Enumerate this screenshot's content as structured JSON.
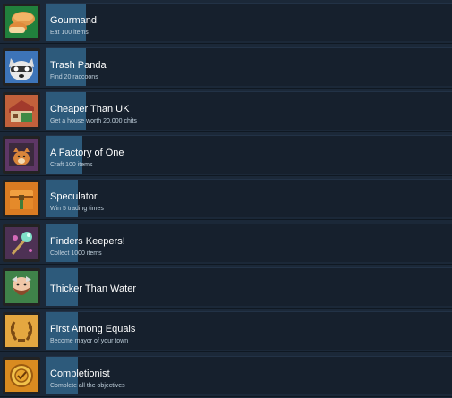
{
  "achievements": [
    {
      "title": "Gourmand",
      "description": "Eat 100 items",
      "icon": "bread-icon",
      "progress": 0.1
    },
    {
      "title": "Trash Panda",
      "description": "Find 20 raccoons",
      "icon": "raccoon-icon",
      "progress": 0.1
    },
    {
      "title": "Cheaper Than UK",
      "description": "Get a house worth 20,000 chits",
      "icon": "house-icon",
      "progress": 0.1
    },
    {
      "title": "A Factory of One",
      "description": "Craft 100 items",
      "icon": "crafting-fox-icon",
      "progress": 0.09
    },
    {
      "title": "Speculator",
      "description": "Win 5 trading times",
      "icon": "treasure-chest-icon",
      "progress": 0.08
    },
    {
      "title": "Finders Keepers!",
      "description": "Collect 1000 items",
      "icon": "gem-wand-icon",
      "progress": 0.08
    },
    {
      "title": "Thicker Than Water",
      "description": "",
      "icon": "bearded-character-icon",
      "progress": 0.08
    },
    {
      "title": "First Among Equals",
      "description": "Become mayor of your town",
      "icon": "laurel-wreath-icon",
      "progress": 0.08
    },
    {
      "title": "Completionist",
      "description": "Complete all the objectives",
      "icon": "gold-medal-icon",
      "progress": 0.08
    }
  ],
  "colors": {
    "background": "#1b2838",
    "card": "#16202d",
    "progress_fill": "#2d5a7b",
    "title_text": "#ffffff",
    "description_text": "#c0d0dc"
  }
}
